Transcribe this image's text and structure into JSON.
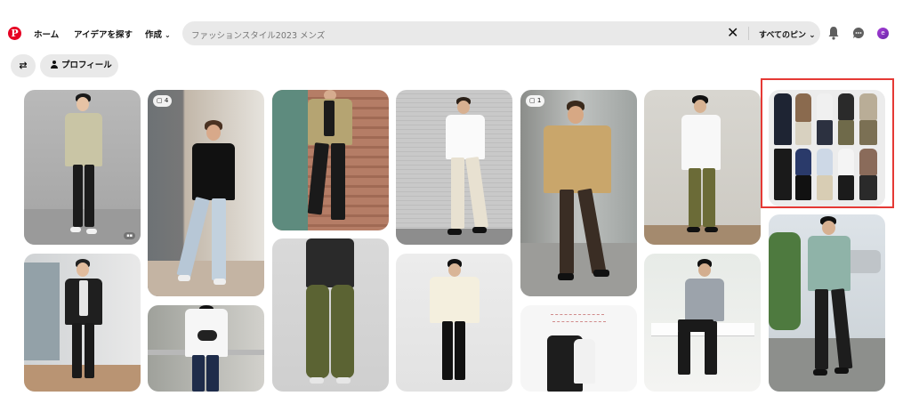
{
  "header": {
    "logo": "P",
    "nav": [
      {
        "label": "ホーム"
      },
      {
        "label": "アイデアを探す"
      },
      {
        "label": "作成"
      }
    ],
    "search": {
      "value": "ファッションスタイル2023 メンズ",
      "clear_icon": "close-icon",
      "scope_label": "すべてのピン"
    },
    "icons": [
      "bell-icon",
      "chat-icon"
    ],
    "avatar_initial": "e"
  },
  "filters": {
    "filter_icon": "swap-icon",
    "profile_label": "プロフィール"
  },
  "pins": [
    {
      "id": "pin-1",
      "badge": ""
    },
    {
      "id": "pin-2",
      "badge": "4"
    },
    {
      "id": "pin-3",
      "badge": ""
    },
    {
      "id": "pin-4",
      "badge": ""
    },
    {
      "id": "pin-5",
      "badge": "1"
    },
    {
      "id": "pin-6",
      "badge": ""
    },
    {
      "id": "pin-7",
      "badge": ""
    },
    {
      "id": "pin-8",
      "badge": ""
    },
    {
      "id": "pin-9",
      "badge": ""
    },
    {
      "id": "pin-10",
      "badge": ""
    },
    {
      "id": "pin-11",
      "badge": ""
    },
    {
      "id": "pin-12",
      "badge": ""
    },
    {
      "id": "pin-13",
      "badge": ""
    },
    {
      "id": "pin-14",
      "badge": ""
    }
  ]
}
